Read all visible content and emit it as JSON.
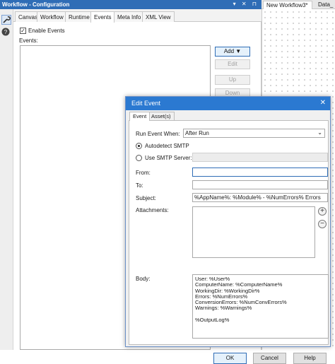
{
  "config_panel": {
    "title": "Workflow - Configuration",
    "header_icons": "▾ ✕ ⊓",
    "tabs": [
      "Canvas",
      "Workflow",
      "Runtime",
      "Events",
      "Meta Info",
      "XML View"
    ],
    "active_tab": "Events",
    "enable_events_label": "Enable Events",
    "enable_events_checked": true,
    "events_label": "Events:",
    "buttons": {
      "add": "Add ▼",
      "edit": "Edit",
      "up": "Up",
      "down": "Down"
    }
  },
  "workspace": {
    "tabs": [
      "New Workflow3*",
      "Data_"
    ]
  },
  "dialog": {
    "title": "Edit Event",
    "close_glyph": "✕",
    "tabs": [
      "Event",
      "Asset(s)"
    ],
    "run_event_when_label": "Run Event When:",
    "run_event_when_value": "After Run",
    "autodetect_smtp_label": "Autodetect SMTP",
    "use_smtp_server_label": "Use SMTP Server:",
    "from_label": "From:",
    "from_value": "",
    "to_label": "To:",
    "to_value": "",
    "subject_label": "Subject:",
    "subject_value": "%AppName%: %Module% - %NumErrors% Errors",
    "attachments_label": "Attachments:",
    "body_label": "Body:",
    "body_lines": [
      "User: %User%",
      "ComputerName: %ComputerName%",
      "WorkingDir: %WorkingDir%",
      "Errors: %NumErrors%",
      "ConversionErrors: %NumConvErrors%",
      "Warnings: %Warnings%",
      "",
      "%OutputLog%"
    ],
    "buttons": {
      "ok": "OK",
      "cancel": "Cancel",
      "help": "Help"
    }
  },
  "colors": {
    "accent": "#2b79d1",
    "header_blue": "#2f6db6"
  }
}
